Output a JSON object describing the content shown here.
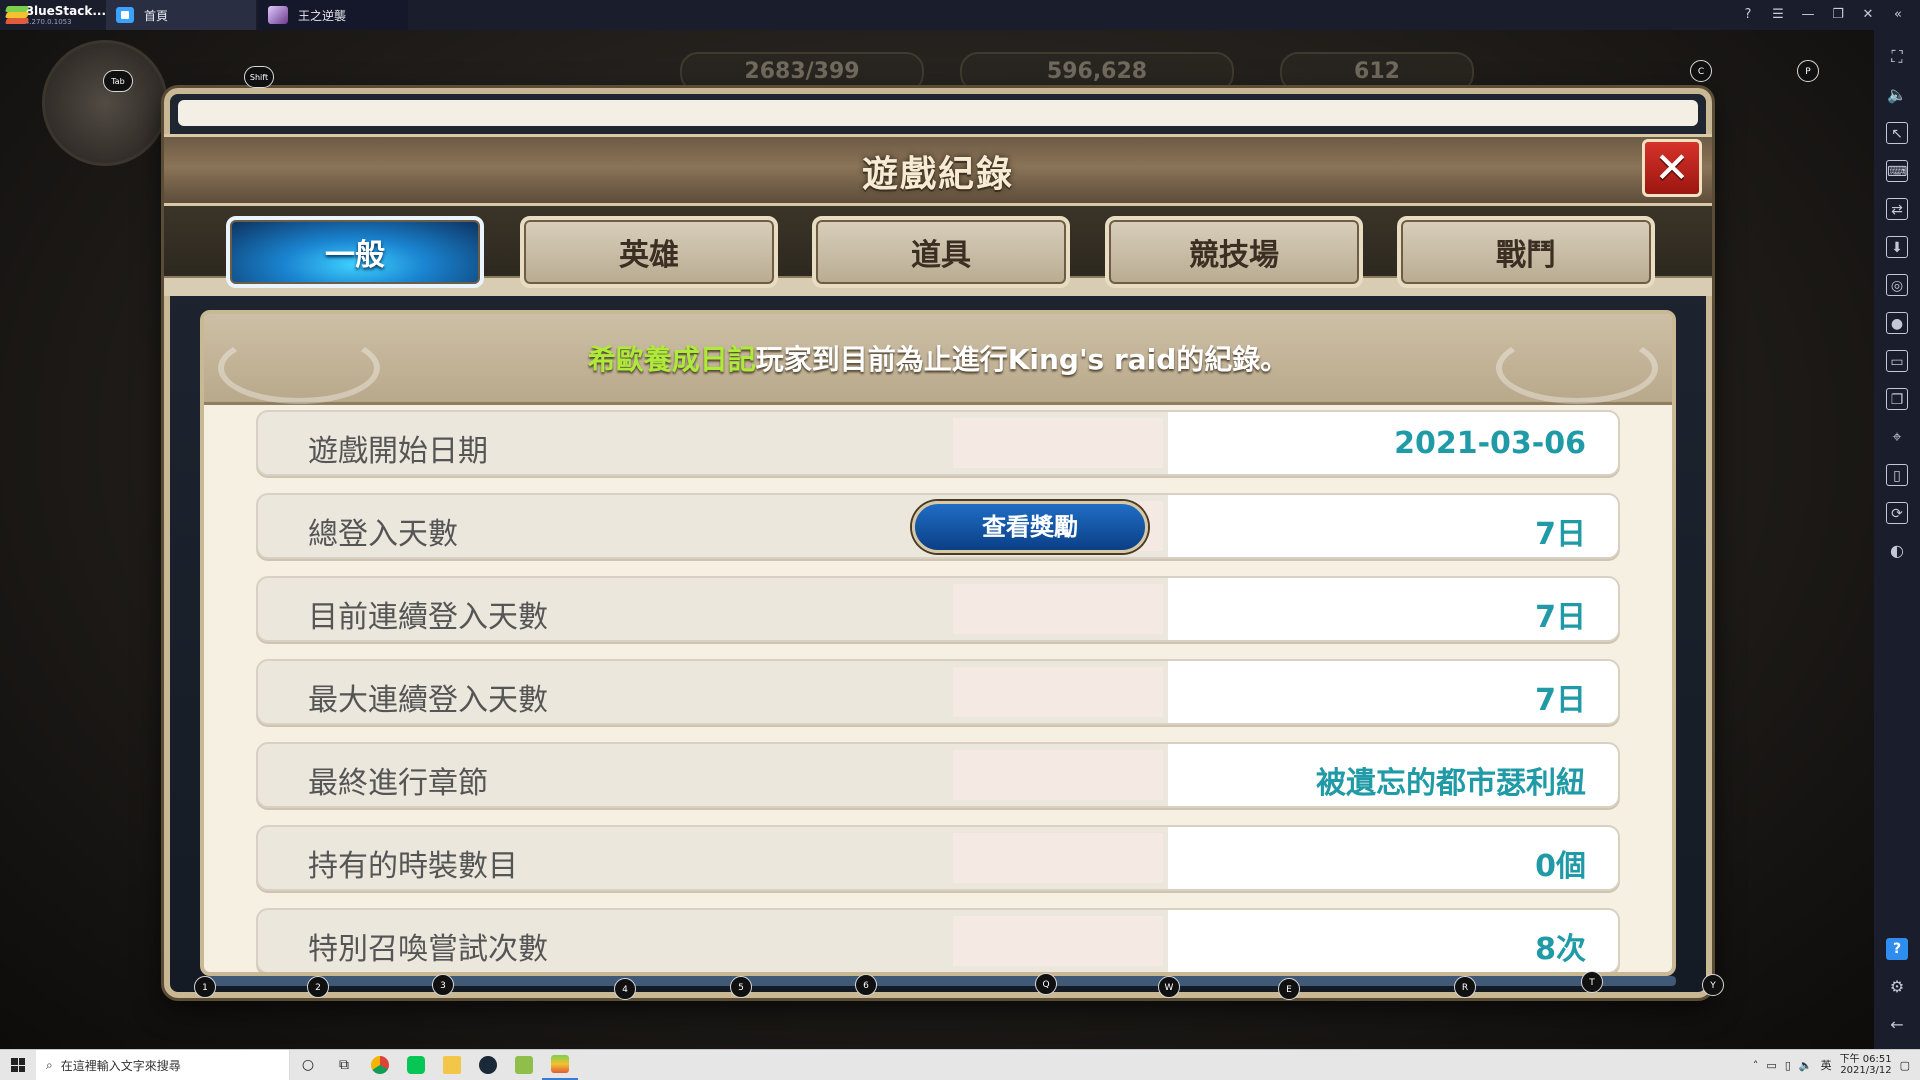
{
  "emulator": {
    "brand": "BlueStack...",
    "version": "4.270.0.1053",
    "tabs": [
      {
        "label": "首頁",
        "icon": "home-icon"
      },
      {
        "label": "王之逆襲",
        "icon": "game-thumbnail-icon"
      }
    ],
    "window_controls": [
      "help-icon",
      "menu-icon",
      "minimize-icon",
      "restore-icon",
      "close-icon"
    ],
    "sidebar_icons": [
      "fullscreen-icon",
      "volume-icon",
      "pointer-icon",
      "keyboard-icon",
      "screen-rotate-icon",
      "install-apk-icon",
      "screenshot-icon",
      "record-icon",
      "folder-icon",
      "multi-instance-icon",
      "location-icon",
      "shake-icon",
      "rotate-icon",
      "gamepad-icon"
    ],
    "sidebar_bottom": [
      "help-icon",
      "settings-icon",
      "back-icon"
    ]
  },
  "hud": {
    "stamina": "2683/399",
    "gold": "596,628",
    "gems": "612"
  },
  "key_hints": {
    "tab": "Tab",
    "shift": "Shift",
    "c": "C",
    "p": "P",
    "row": [
      "1",
      "2",
      "3",
      "4",
      "5",
      "6",
      "Q",
      "W",
      "E",
      "R",
      "T",
      "Y"
    ]
  },
  "dialog": {
    "title": "遊戲紀錄",
    "tabs": [
      {
        "label": "一般",
        "active": true
      },
      {
        "label": "英雄",
        "active": false
      },
      {
        "label": "道具",
        "active": false
      },
      {
        "label": "競技場",
        "active": false
      },
      {
        "label": "戰鬥",
        "active": false
      }
    ],
    "banner": {
      "player_name": "希歐養成日記",
      "text": "玩家到目前為止進行King's raid的紀錄。"
    },
    "records": [
      {
        "label": "遊戲開始日期",
        "value": "2021-03-06"
      },
      {
        "label": "總登入天數",
        "value": "7日",
        "button": "查看獎勵"
      },
      {
        "label": "目前連續登入天數",
        "value": "7日"
      },
      {
        "label": "最大連續登入天數",
        "value": "7日"
      },
      {
        "label": "最終進行章節",
        "value": "被遺忘的都市瑟利紐"
      },
      {
        "label": "持有的時裝數目",
        "value": "0個"
      },
      {
        "label": "特別召喚嘗試次數",
        "value": "8次"
      }
    ]
  },
  "taskbar": {
    "search_placeholder": "在這裡輸入文字來搜尋",
    "tray_lang": "英",
    "time": "下午 06:51",
    "date": "2021/3/12"
  },
  "colors": {
    "accent_green": "#aeea3a",
    "value_teal": "#1f9aa6",
    "close_red": "#d6322a",
    "tab_blue": "#1a84d0"
  }
}
